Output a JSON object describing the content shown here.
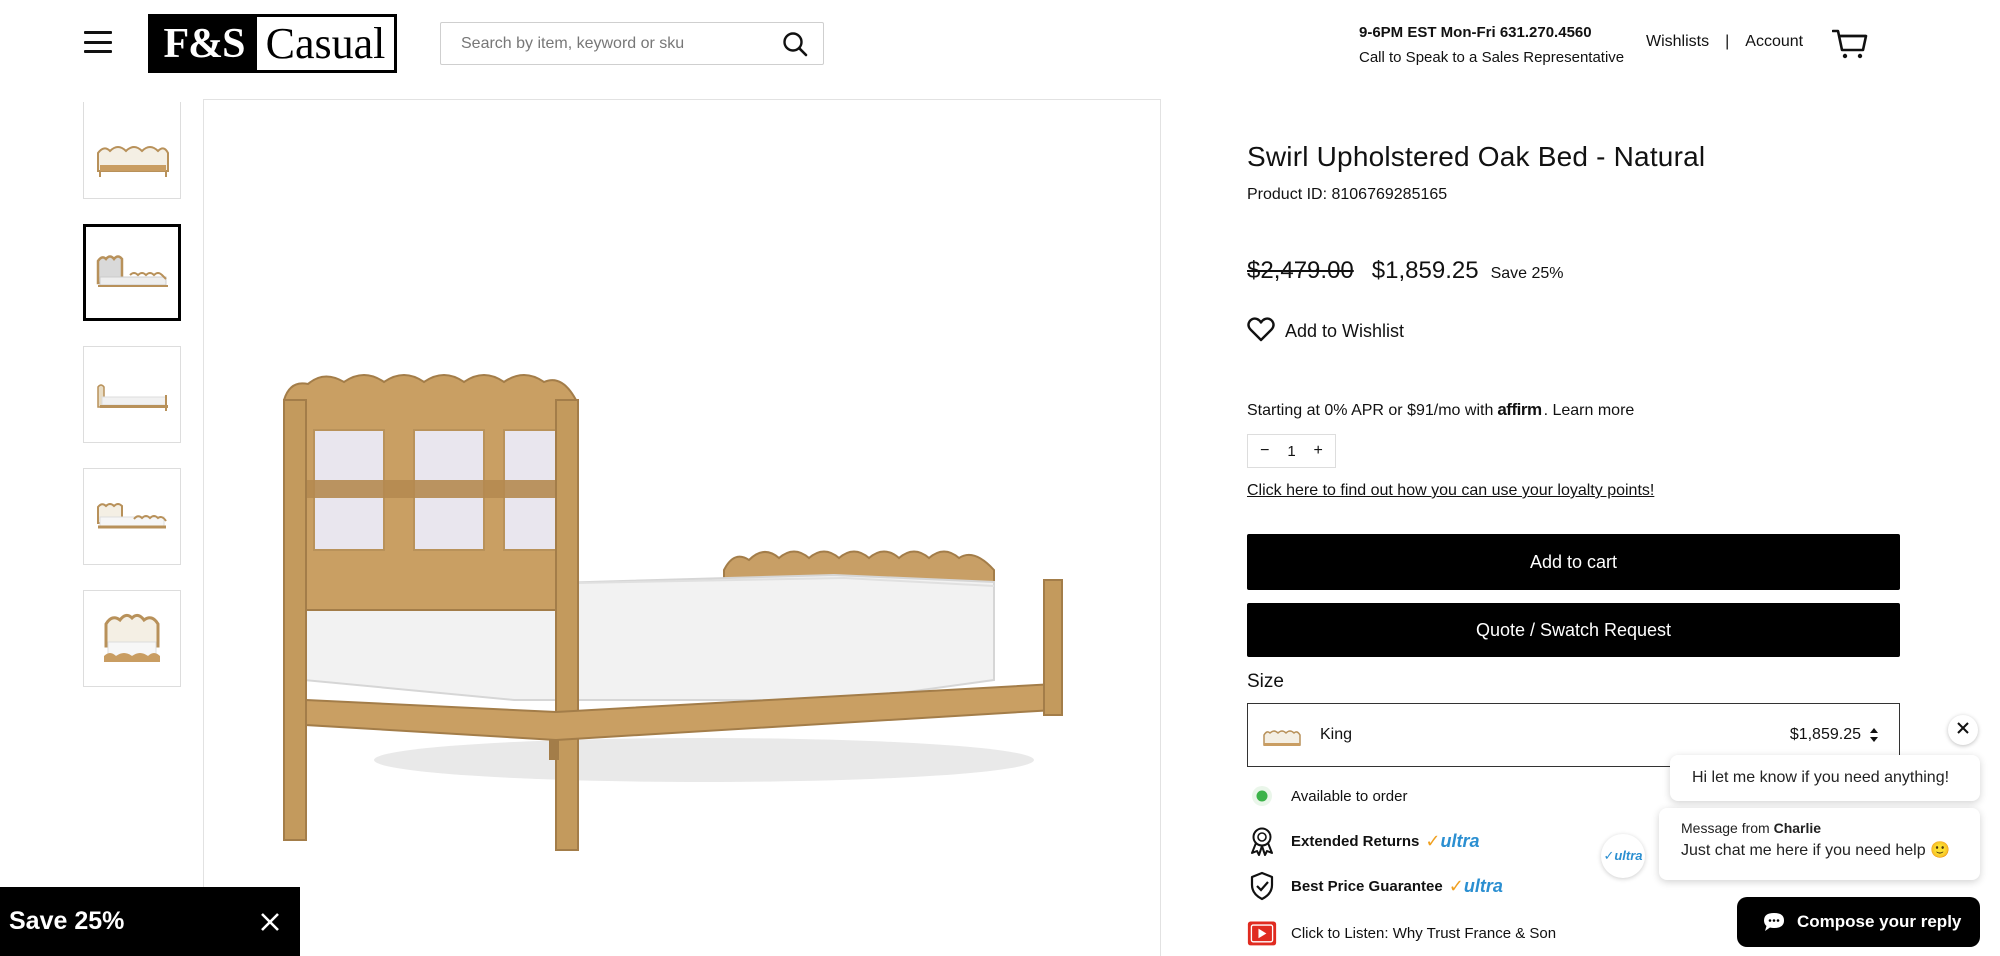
{
  "header": {
    "logo_left": "F&S",
    "logo_right": "Casual",
    "search_placeholder": "Search by item, keyword or sku",
    "phone_line1": "9-6PM EST Mon-Fri 631.270.4560",
    "phone_line2": "Call to Speak to a Sales Representative",
    "wishlists": "Wishlists",
    "separator": "|",
    "account": "Account"
  },
  "gallery": {
    "thumbnail_count": 5,
    "active_index": 1
  },
  "promo": {
    "banner_text": "Save 25%"
  },
  "product": {
    "title": "Swirl Upholstered Oak Bed - Natural",
    "product_id": "Product ID: 8106769285165",
    "price_original": "$2,479.00",
    "price_sale": "$1,859.25",
    "save_label": "Save 25%",
    "wishlist_label": "Add to Wishlist",
    "affirm_prefix": "Starting at 0% APR or $91/mo with",
    "affirm_brand": "affirm",
    "affirm_link": ". Learn more",
    "quantity": "1",
    "qty_minus": "−",
    "qty_plus": "+",
    "loyalty_link": "Click here to find out how you can use your loyalty points!",
    "add_to_cart": "Add to cart",
    "quote_request": "Quote / Swatch Request",
    "size_label": "Size",
    "size_selected": "King",
    "size_price": "$1,859.25",
    "availability": "Available to order",
    "extended_returns": "Extended Returns",
    "best_price": "Best Price Guarantee",
    "ultra_label": "ultra",
    "ultra_tick": "✓",
    "listen": "Click to Listen: Why Trust France & Son"
  },
  "chat": {
    "bubble1": "Hi let me know if you need anything!",
    "from_prefix": "Message from",
    "from_name": "Charlie",
    "bubble2": "Just chat me here if you need help 🙂",
    "avatar_text": "✓ultra",
    "compose": "Compose your reply"
  },
  "colors": {
    "accent_blue": "#2b8fd1",
    "available_green": "#3cb34a",
    "youtube_red": "#e02b20",
    "button_black": "#000000"
  },
  "icons": [
    "hamburger-icon",
    "search-icon",
    "cart-icon",
    "chevron-up-icon",
    "close-icon",
    "heart-icon",
    "award-icon",
    "shield-check-icon",
    "youtube-icon",
    "chat-icon",
    "select-arrows-icon"
  ]
}
